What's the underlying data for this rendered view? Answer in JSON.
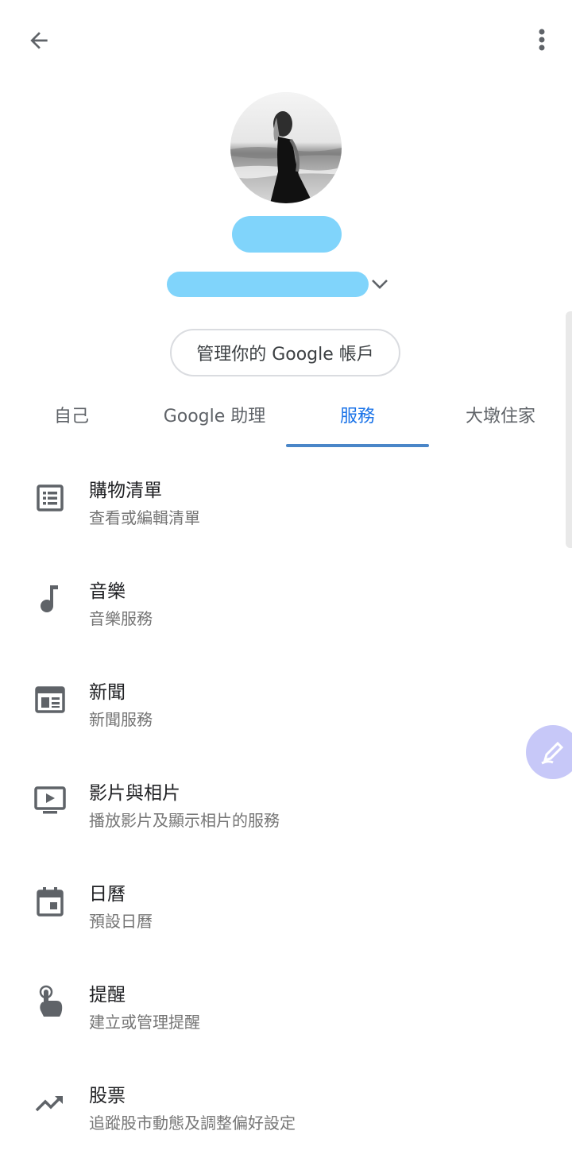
{
  "header": {
    "back_icon": "arrow-back-icon",
    "more_icon": "more-vert-icon"
  },
  "profile": {
    "manage_account_label": "管理你的 Google 帳戶",
    "chevron_icon": "chevron-down-icon"
  },
  "tabs": [
    {
      "label": "自己"
    },
    {
      "label": "Google 助理"
    },
    {
      "label": "服務",
      "active": true
    },
    {
      "label": "大墩住家"
    }
  ],
  "services": [
    {
      "title": "購物清單",
      "subtitle": "查看或編輯清單",
      "icon": "list-alt-icon"
    },
    {
      "title": "音樂",
      "subtitle": "音樂服務",
      "icon": "music-note-icon"
    },
    {
      "title": "新聞",
      "subtitle": "新聞服務",
      "icon": "newspaper-icon"
    },
    {
      "title": "影片與相片",
      "subtitle": "播放影片及顯示相片的服務",
      "icon": "tv-play-icon"
    },
    {
      "title": "日曆",
      "subtitle": "預設日曆",
      "icon": "calendar-icon"
    },
    {
      "title": "提醒",
      "subtitle": "建立或管理提醒",
      "icon": "touch-finger-icon"
    },
    {
      "title": "股票",
      "subtitle": "追蹤股市動態及調整偏好設定",
      "icon": "trending-up-icon"
    }
  ],
  "colors": {
    "accent": "#1a73e8",
    "tab_indicator": "#4a86c8",
    "icon_gray": "#5f6368",
    "redaction": "#80d4fb",
    "fab": "#c7c8f8"
  }
}
